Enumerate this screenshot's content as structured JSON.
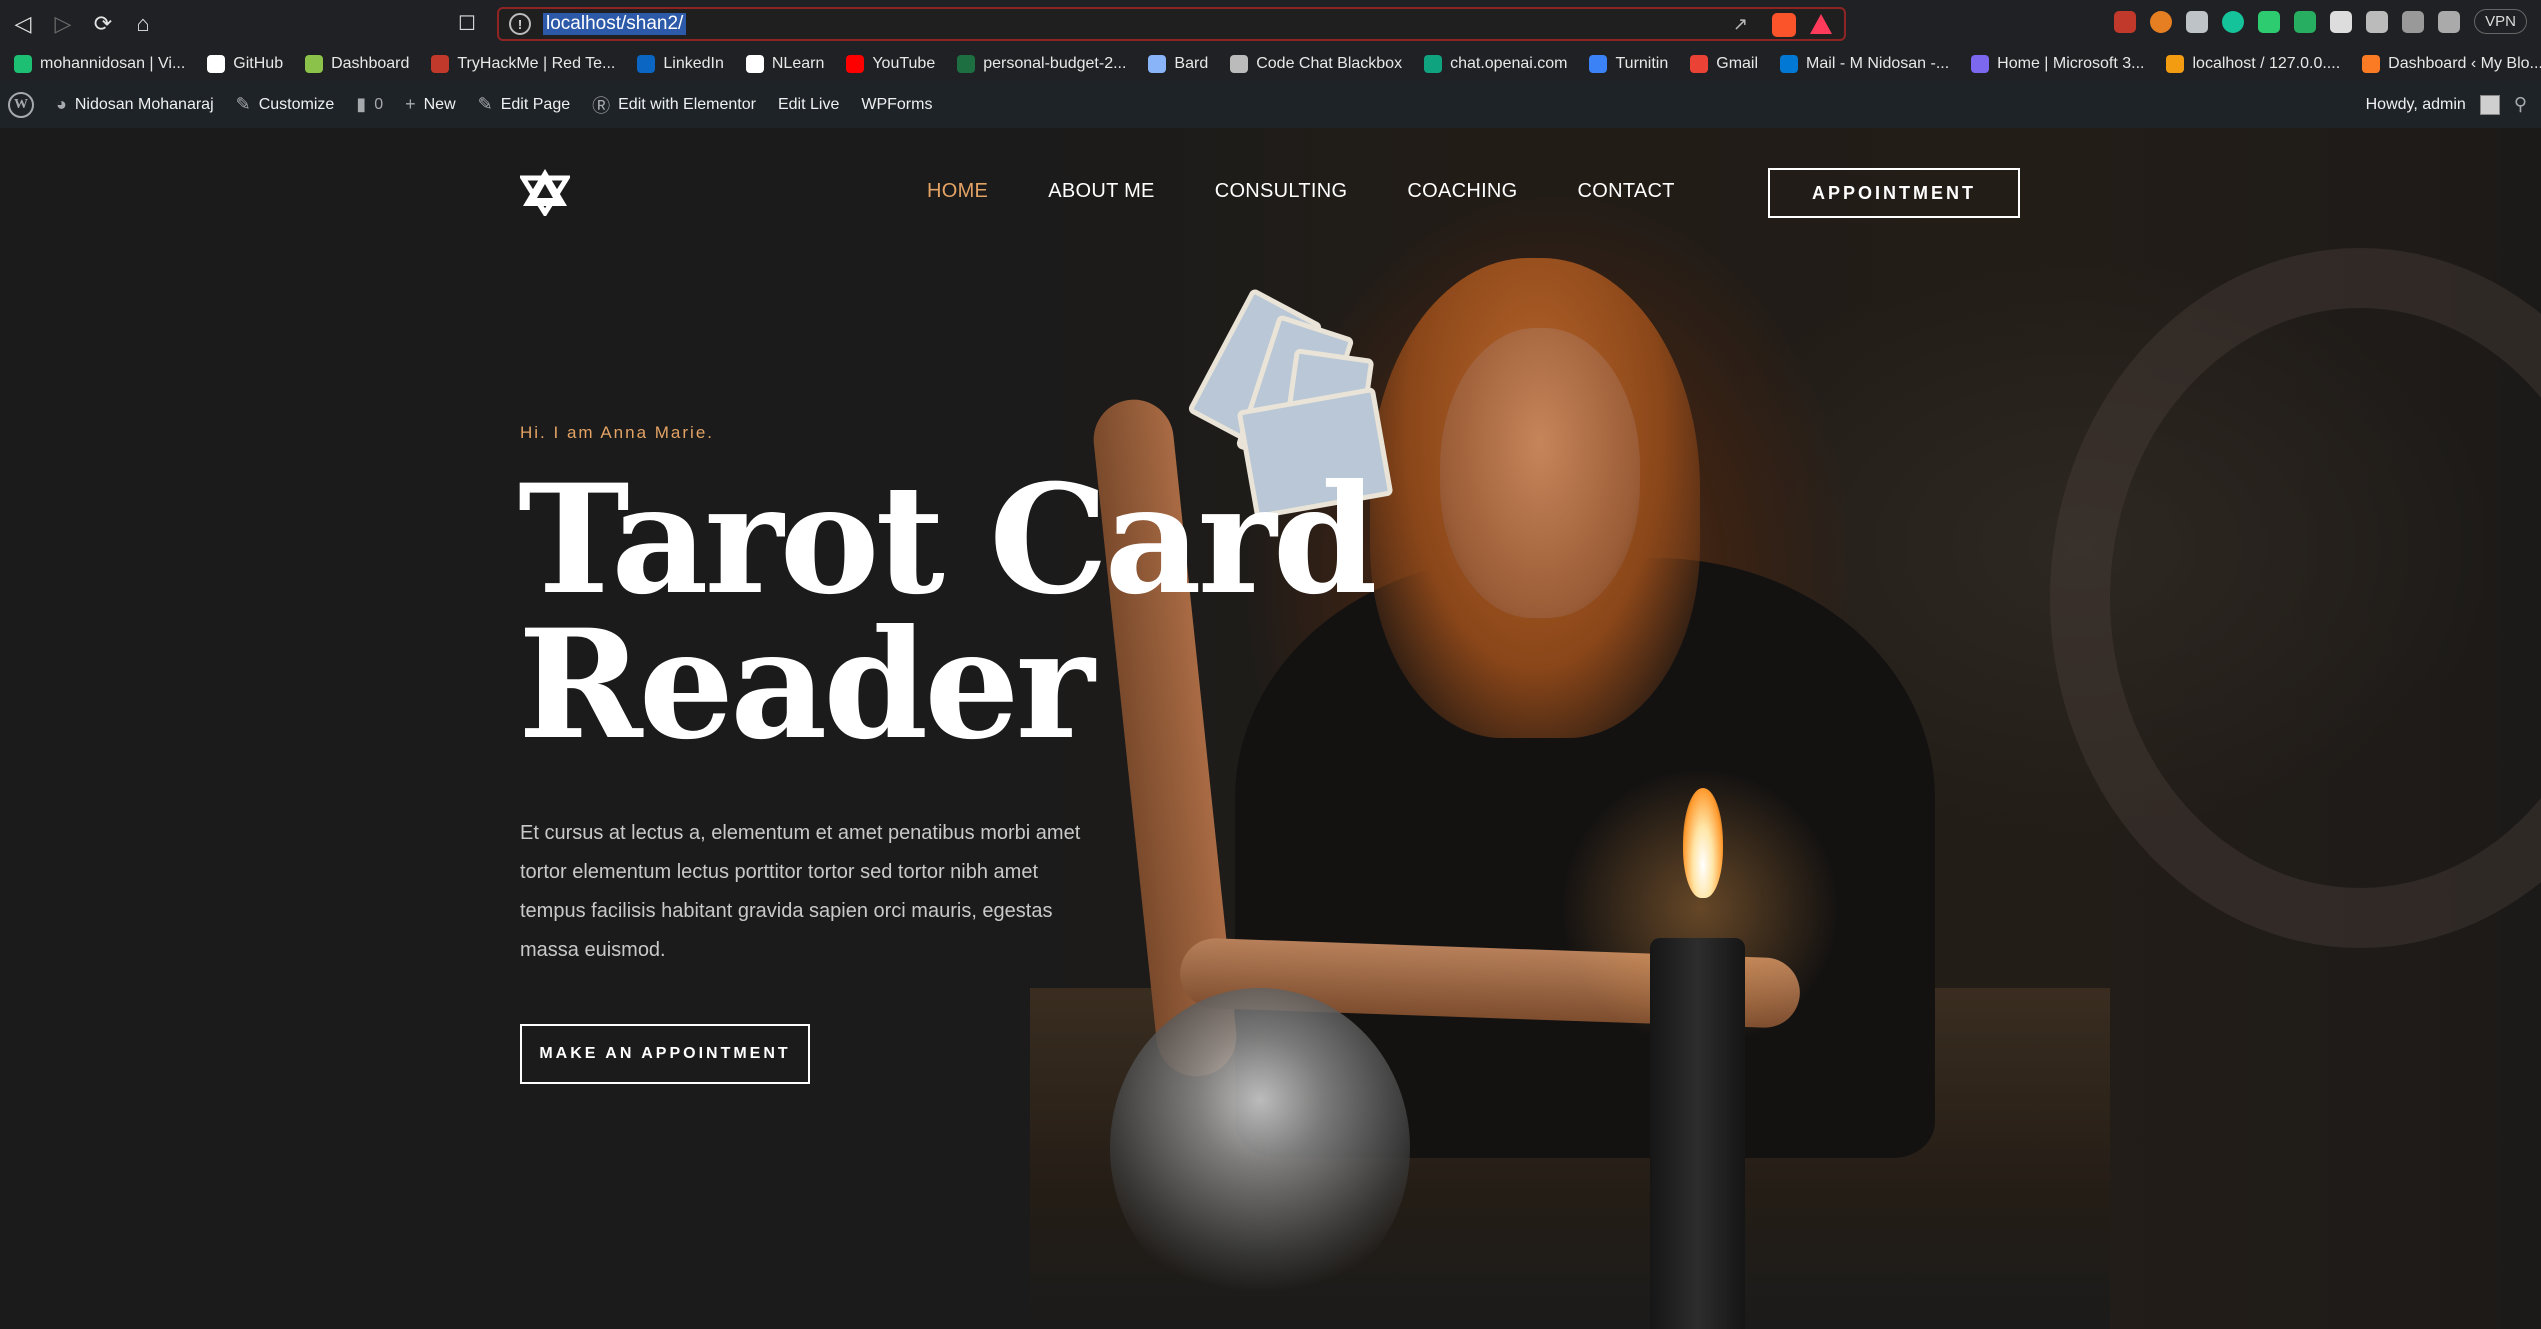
{
  "browser": {
    "url": "localhost/shan2/",
    "vpn_label": "VPN",
    "bookmarks": [
      {
        "label": "mohannidosan | Vi...",
        "icon": "fiverr-icon",
        "color": "#1dbf73"
      },
      {
        "label": "GitHub",
        "icon": "github-icon",
        "color": "#ffffff"
      },
      {
        "label": "Dashboard",
        "icon": "cube-icon",
        "color": "#8bc34a"
      },
      {
        "label": "TryHackMe | Red Te...",
        "icon": "tryhackme-icon",
        "color": "#c0392b"
      },
      {
        "label": "LinkedIn",
        "icon": "linkedin-icon",
        "color": "#0a66c2"
      },
      {
        "label": "NLearn",
        "icon": "nlearn-icon",
        "color": "#ffffff"
      },
      {
        "label": "YouTube",
        "icon": "youtube-icon",
        "color": "#ff0000"
      },
      {
        "label": "personal-budget-2...",
        "icon": "excel-icon",
        "color": "#1d6f42"
      },
      {
        "label": "Bard",
        "icon": "bard-icon",
        "color": "#8ab4f8"
      },
      {
        "label": "Code Chat Blackbox",
        "icon": "blackbox-icon",
        "color": "#bbbbbb"
      },
      {
        "label": "chat.openai.com",
        "icon": "openai-icon",
        "color": "#10a37f"
      },
      {
        "label": "Turnitin",
        "icon": "turnitin-icon",
        "color": "#3b82f6"
      },
      {
        "label": "Gmail",
        "icon": "gmail-icon",
        "color": "#ea4335"
      },
      {
        "label": "Mail - M Nidosan -...",
        "icon": "outlook-icon",
        "color": "#0078d4"
      },
      {
        "label": "Home | Microsoft 3...",
        "icon": "microsoft-icon",
        "color": "#7b68ee"
      },
      {
        "label": "localhost / 127.0.0....",
        "icon": "phpmyadmin-icon",
        "color": "#f39c12"
      },
      {
        "label": "Dashboard ‹ My Blo...",
        "icon": "xampp-icon",
        "color": "#fb7a24"
      }
    ]
  },
  "wp_admin_bar": {
    "site_name": "Nidosan Mohanaraj",
    "customize": "Customize",
    "comments_count": "0",
    "new": "New",
    "edit_page": "Edit Page",
    "edit_elementor": "Edit with Elementor",
    "edit_live": "Edit Live",
    "wpforms": "WPForms",
    "howdy": "Howdy, admin"
  },
  "site": {
    "nav": [
      {
        "label": "HOME",
        "active": true
      },
      {
        "label": "ABOUT ME",
        "active": false
      },
      {
        "label": "CONSULTING",
        "active": false
      },
      {
        "label": "COACHING",
        "active": false
      },
      {
        "label": "CONTACT",
        "active": false
      }
    ],
    "appointment_button": "APPOINTMENT",
    "accent_color": "#e3a365"
  },
  "hero": {
    "eyebrow": "Hi. I am Anna Marie.",
    "title_line1": "Tarot Card",
    "title_line2": "Reader",
    "description": "Et cursus at lectus a, elementum et amet penatibus morbi amet tortor elementum lectus porttitor tortor sed tortor nibh amet tempus facilisis habitant gravida sapien orci mauris, egestas massa euismod.",
    "cta": "MAKE AN APPOINTMENT"
  }
}
